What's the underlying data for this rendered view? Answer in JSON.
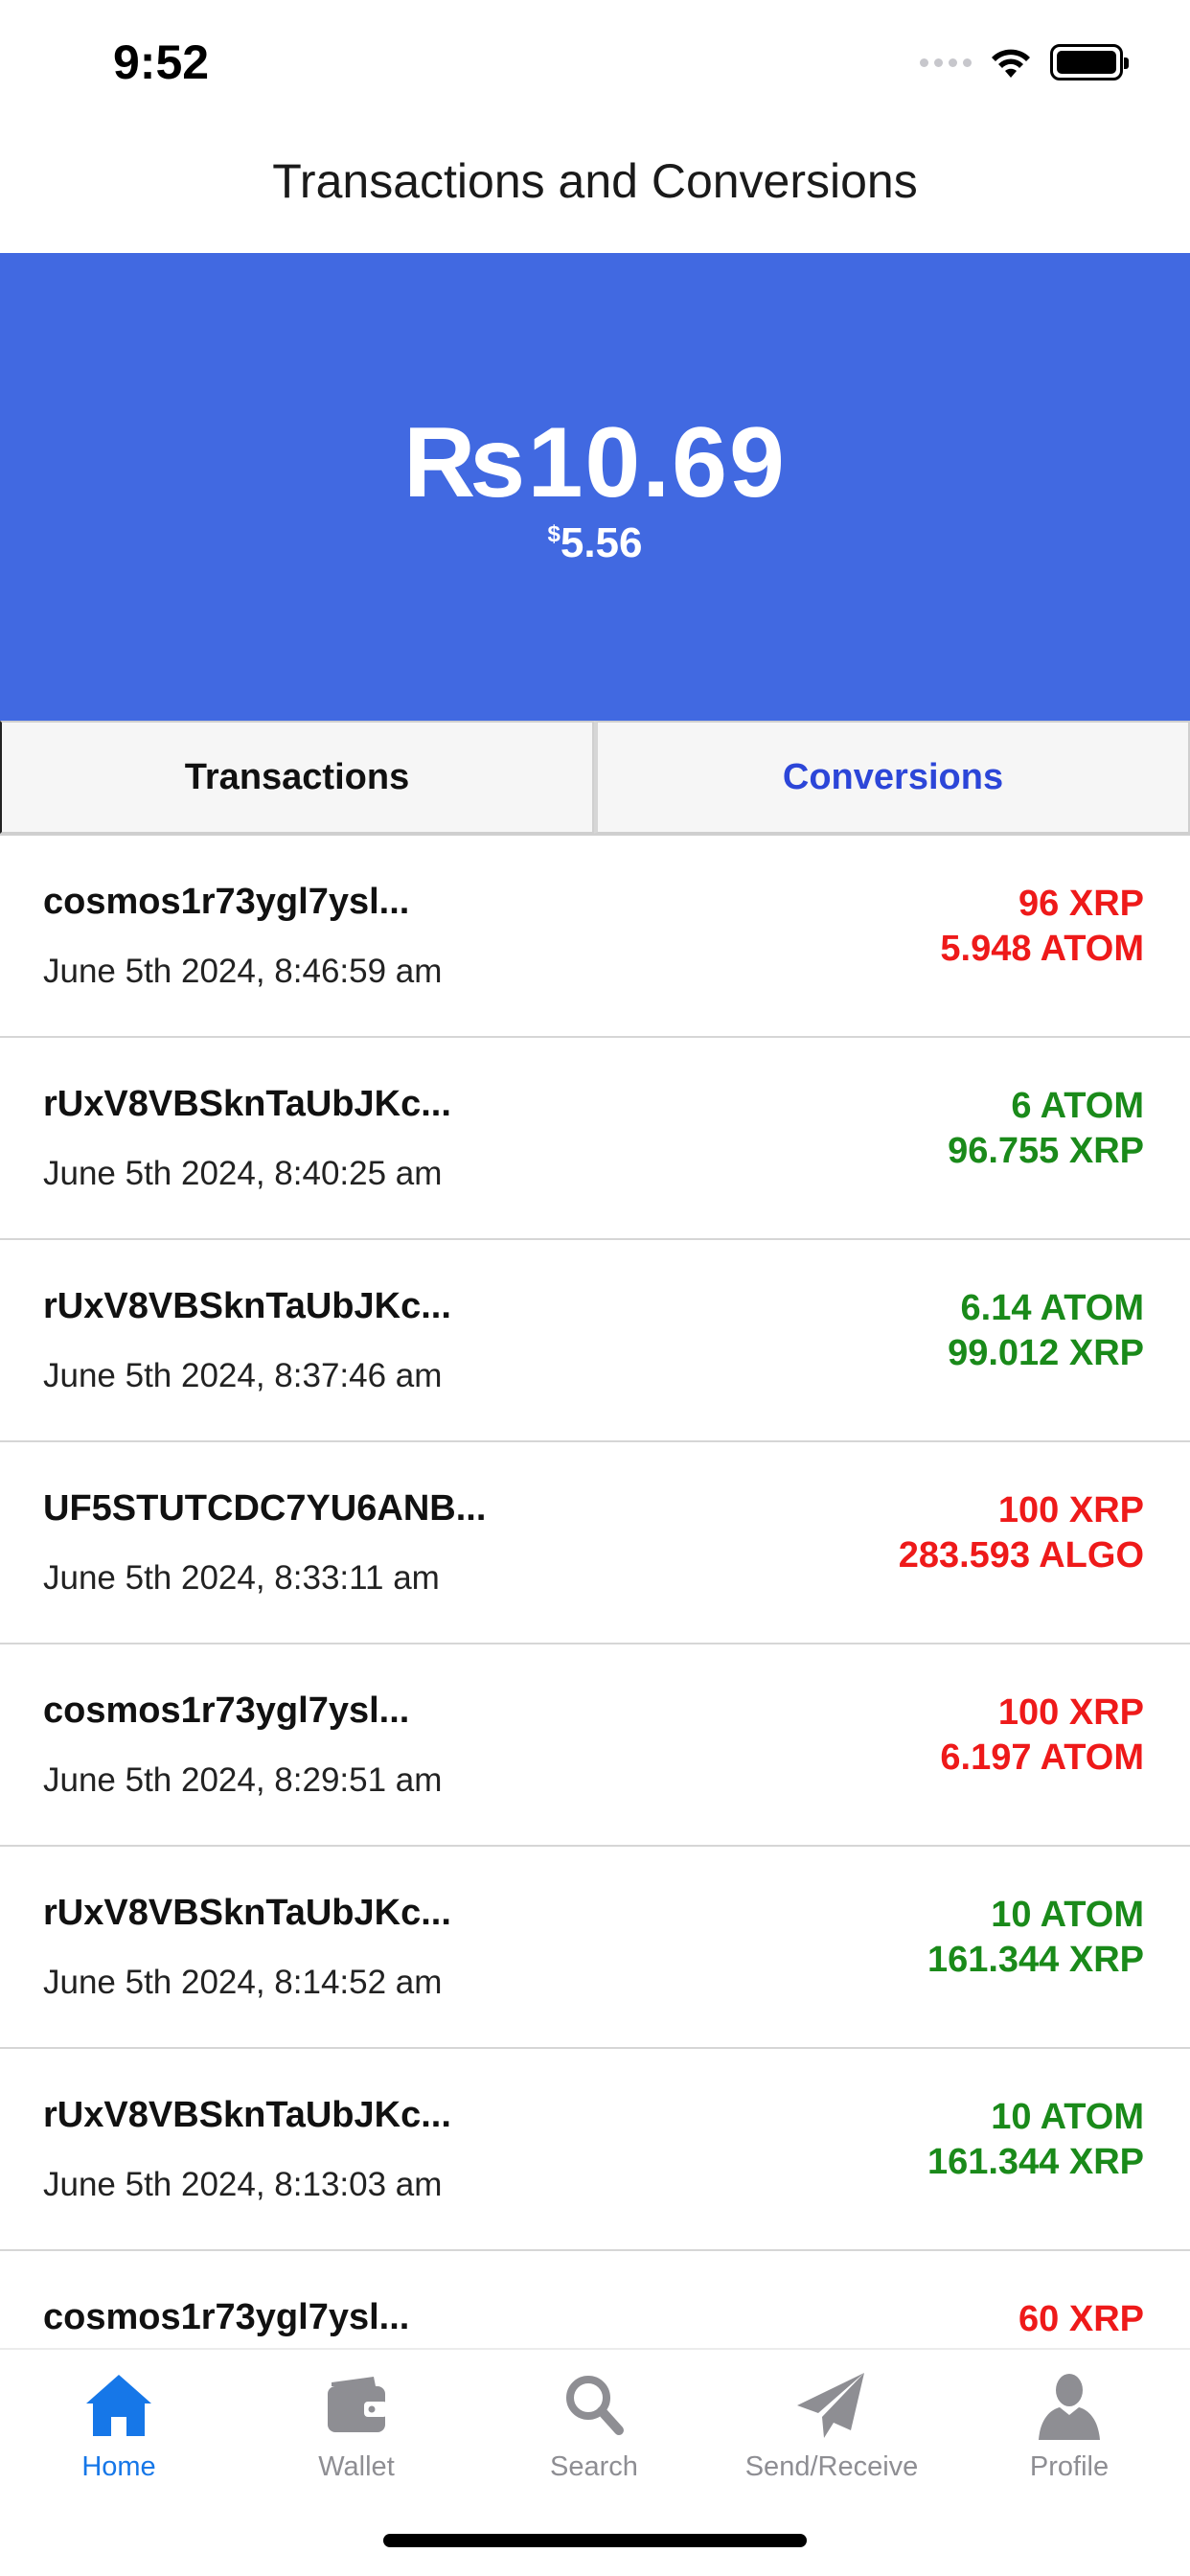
{
  "status_bar": {
    "time": "9:52"
  },
  "header": {
    "title": "Transactions and Conversions"
  },
  "balance": {
    "main": "₨10.69",
    "sub_symbol": "$",
    "sub_value": "5.56"
  },
  "tabs": [
    {
      "label": "Transactions",
      "selected": false
    },
    {
      "label": "Conversions",
      "selected": true
    }
  ],
  "transactions": [
    {
      "address": "cosmos1r73ygl7ysl...",
      "date": "June 5th 2024, 8:46:59 am",
      "amount_1": "96 XRP",
      "amount_2": "5.948 ATOM",
      "color": "#ee1a1a"
    },
    {
      "address": "rUxV8VBSknTaUbJKc...",
      "date": "June 5th 2024, 8:40:25 am",
      "amount_1": "6 ATOM",
      "amount_2": "96.755 XRP",
      "color": "#1a8a1a"
    },
    {
      "address": "rUxV8VBSknTaUbJKc...",
      "date": "June 5th 2024, 8:37:46 am",
      "amount_1": "6.14 ATOM",
      "amount_2": "99.012 XRP",
      "color": "#1a8a1a"
    },
    {
      "address": "UF5STUTCDC7YU6ANB...",
      "date": "June 5th 2024, 8:33:11 am",
      "amount_1": "100 XRP",
      "amount_2": "283.593 ALGO",
      "color": "#ee1a1a"
    },
    {
      "address": "cosmos1r73ygl7ysl...",
      "date": "June 5th 2024, 8:29:51 am",
      "amount_1": "100 XRP",
      "amount_2": "6.197 ATOM",
      "color": "#ee1a1a"
    },
    {
      "address": "rUxV8VBSknTaUbJKc...",
      "date": "June 5th 2024, 8:14:52 am",
      "amount_1": "10 ATOM",
      "amount_2": "161.344 XRP",
      "color": "#1a8a1a"
    },
    {
      "address": "rUxV8VBSknTaUbJKc...",
      "date": "June 5th 2024, 8:13:03 am",
      "amount_1": "10 ATOM",
      "amount_2": "161.344 XRP",
      "color": "#1a8a1a"
    },
    {
      "address": "cosmos1r73ygl7ysl...",
      "date": "",
      "amount_1": "60 XRP",
      "amount_2": "",
      "color": "#ee1a1a"
    }
  ],
  "tabbar": [
    {
      "label": "Home",
      "icon": "home-icon",
      "active": true
    },
    {
      "label": "Wallet",
      "icon": "wallet-icon",
      "active": false
    },
    {
      "label": "Search",
      "icon": "search-icon",
      "active": false
    },
    {
      "label": "Send/Receive",
      "icon": "paper-plane-icon",
      "active": false
    },
    {
      "label": "Profile",
      "icon": "user-icon",
      "active": false
    }
  ],
  "colors": {
    "accent": "#4169e1",
    "tab_active": "#1677e8",
    "tab_inactive": "#8e8e93",
    "debit": "#ee1a1a",
    "credit": "#1a8a1a"
  }
}
